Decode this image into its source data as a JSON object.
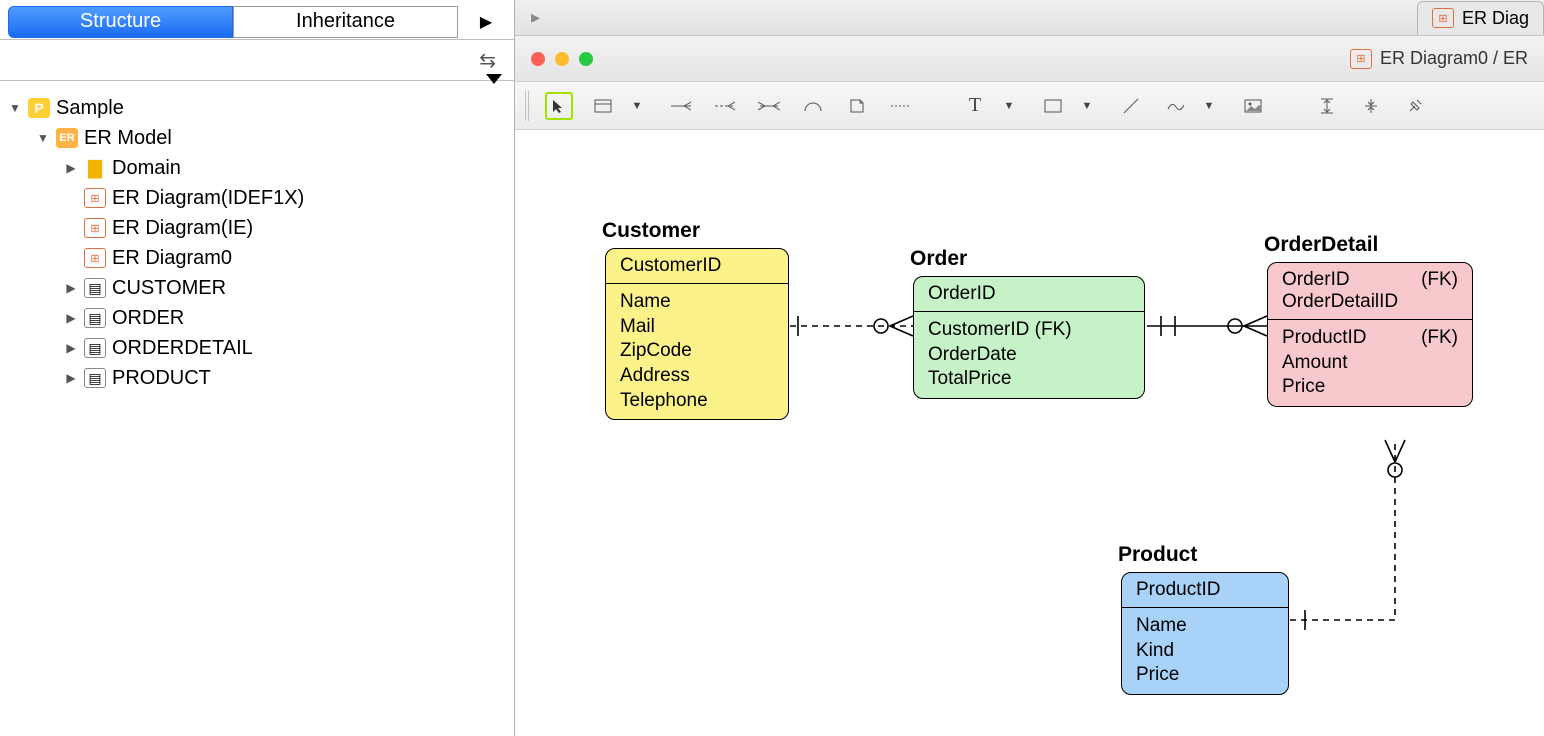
{
  "tabs": {
    "structure": "Structure",
    "inheritance": "Inheritance"
  },
  "tree": {
    "root": "Sample",
    "model": "ER Model",
    "domain": "Domain",
    "diagrams": [
      "ER Diagram(IDEF1X)",
      "ER Diagram(IE)",
      "ER Diagram0"
    ],
    "tables": [
      "CUSTOMER",
      "ORDER",
      "ORDERDETAIL",
      "PRODUCT"
    ]
  },
  "doc_tab": "ER Diag",
  "window_title": "ER Diagram0 / ER",
  "entities": {
    "customer": {
      "title": "Customer",
      "pk": "CustomerID",
      "attrs": [
        "Name",
        "Mail",
        "ZipCode",
        "Address",
        "Telephone"
      ]
    },
    "order": {
      "title": "Order",
      "pk": "OrderID",
      "attrs": [
        "CustomerID (FK)",
        "OrderDate",
        "TotalPrice"
      ]
    },
    "detail": {
      "title": "OrderDetail",
      "pk1": "OrderID",
      "pk1_fk": "(FK)",
      "pk2": "OrderDetailID",
      "a1": "ProductID",
      "a1_fk": "(FK)",
      "a2": "Amount",
      "a3": "Price"
    },
    "product": {
      "title": "Product",
      "pk": "ProductID",
      "attrs": [
        "Name",
        "Kind",
        "Price"
      ]
    }
  },
  "chart_data": {
    "type": "er-diagram",
    "entities": [
      {
        "name": "Customer",
        "pk": [
          "CustomerID"
        ],
        "attributes": [
          "Name",
          "Mail",
          "ZipCode",
          "Address",
          "Telephone"
        ],
        "color": "#fbf28a"
      },
      {
        "name": "Order",
        "pk": [
          "OrderID"
        ],
        "attributes": [
          "CustomerID (FK)",
          "OrderDate",
          "TotalPrice"
        ],
        "color": "#c6f2c7"
      },
      {
        "name": "OrderDetail",
        "pk": [
          "OrderID (FK)",
          "OrderDetailID"
        ],
        "attributes": [
          "ProductID (FK)",
          "Amount",
          "Price"
        ],
        "color": "#f7c9cd"
      },
      {
        "name": "Product",
        "pk": [
          "ProductID"
        ],
        "attributes": [
          "Name",
          "Kind",
          "Price"
        ],
        "color": "#a8d2f7"
      }
    ],
    "relationships": [
      {
        "from": "Customer",
        "to": "Order",
        "type": "one-to-many",
        "identifying": false
      },
      {
        "from": "Order",
        "to": "OrderDetail",
        "type": "one-to-many",
        "identifying": true
      },
      {
        "from": "Product",
        "to": "OrderDetail",
        "type": "one-to-many",
        "identifying": false
      }
    ]
  }
}
